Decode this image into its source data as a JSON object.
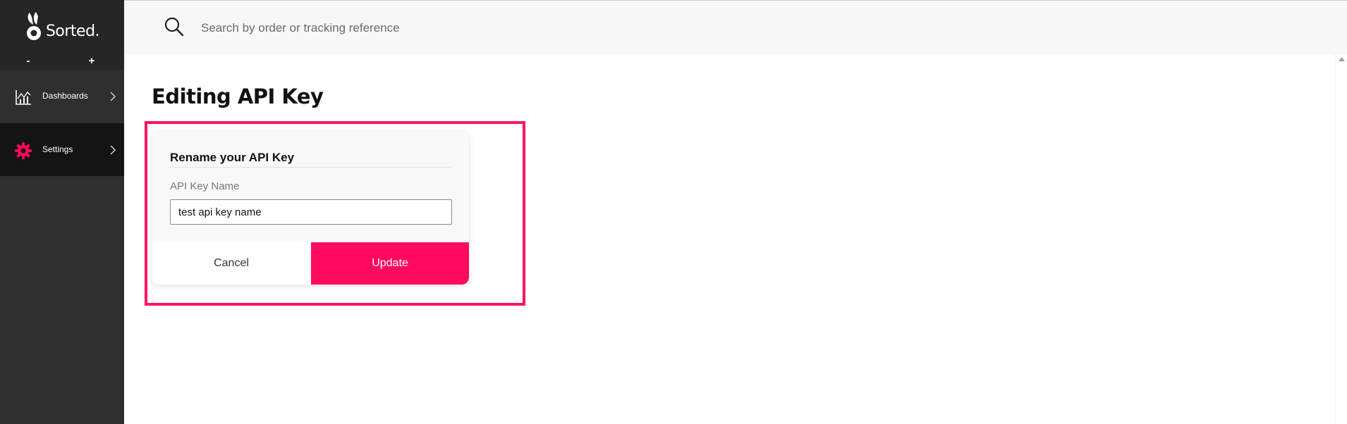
{
  "brand": {
    "name": "Sorted."
  },
  "zoom": {
    "minus_label": "-",
    "plus_label": "+"
  },
  "sidebar": {
    "items": [
      {
        "label": "Dashboards",
        "icon": "chart-icon"
      },
      {
        "label": "Settings",
        "icon": "gear-icon"
      }
    ]
  },
  "search": {
    "placeholder": "Search by order or tracking reference",
    "value": ""
  },
  "main": {
    "title": "Editing API Key",
    "card": {
      "title": "Rename your API Key",
      "field_label": "API Key Name",
      "field_value": "test api key name",
      "cancel_label": "Cancel",
      "update_label": "Update"
    }
  },
  "colors": {
    "accent": "#ff0a5e",
    "sidebar_bg": "#2f2f2f",
    "sidebar_active_bg": "#141414",
    "highlight_frame": "#ff1464"
  }
}
